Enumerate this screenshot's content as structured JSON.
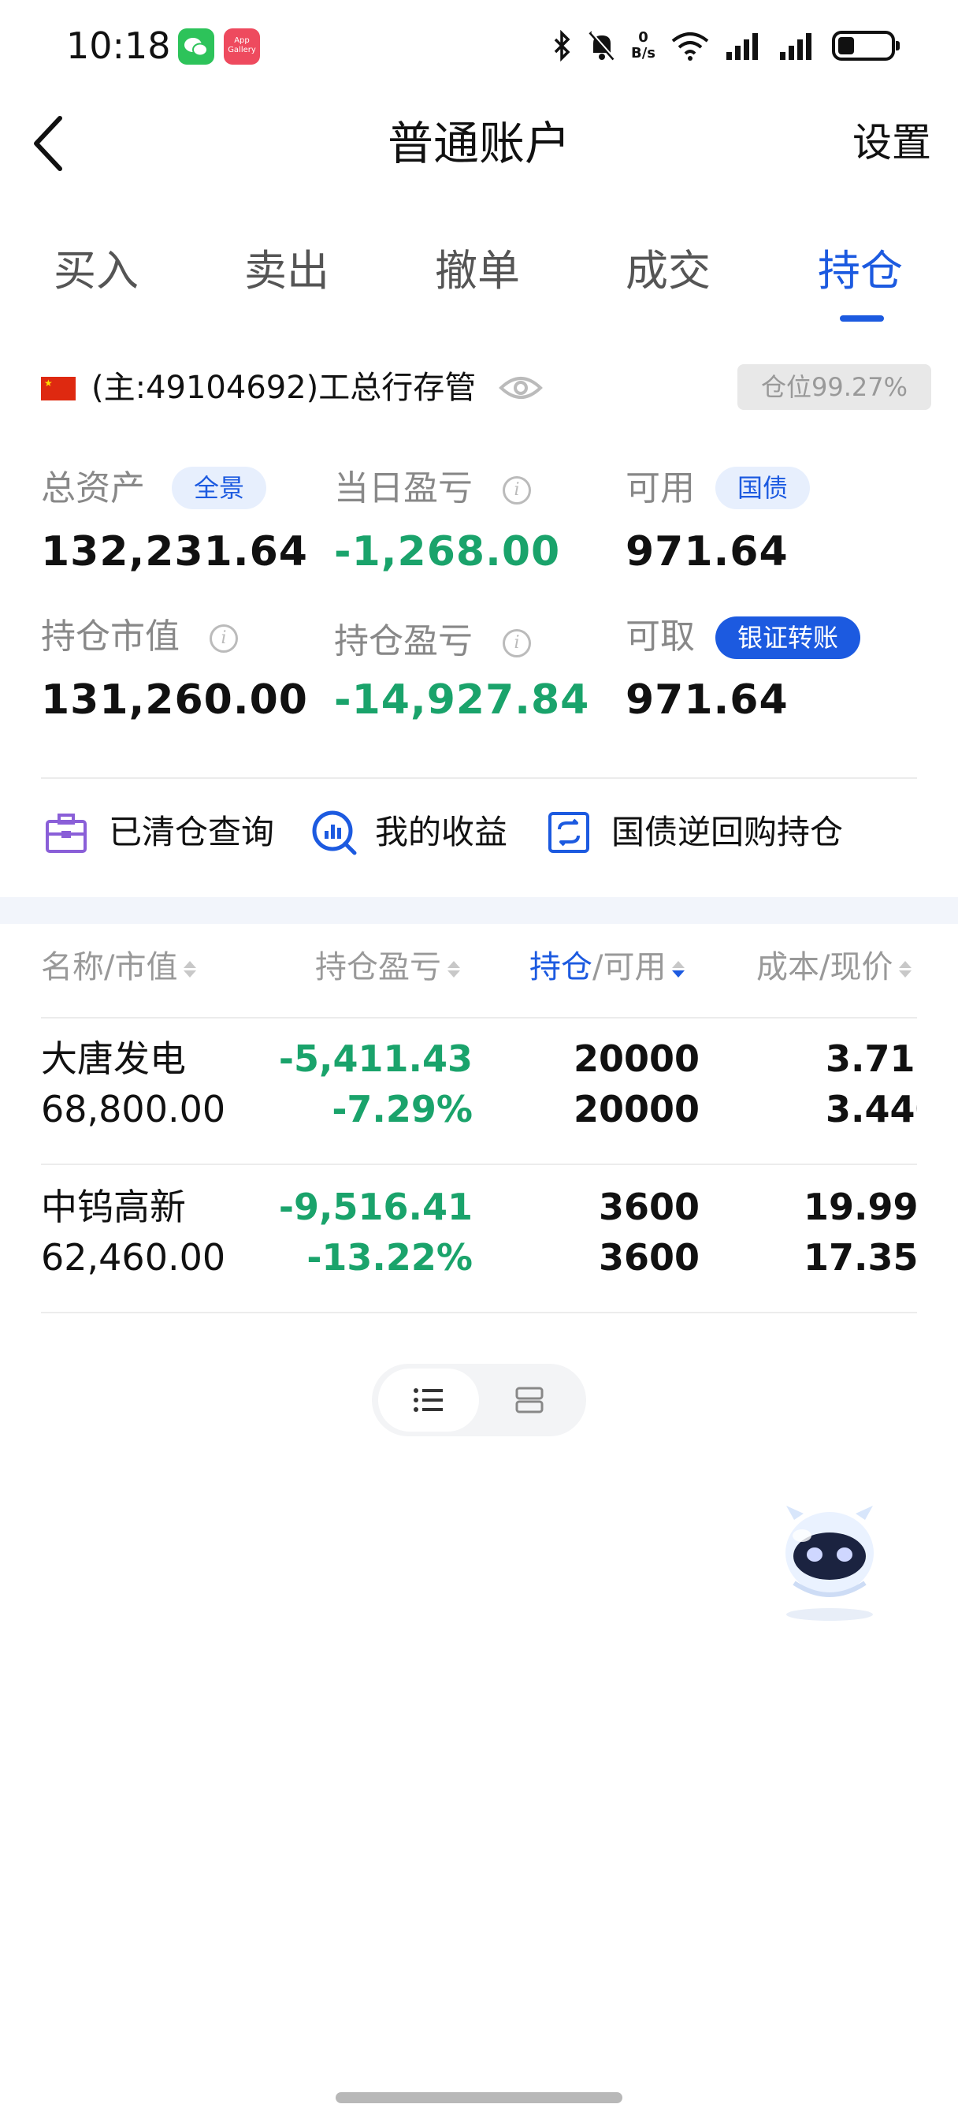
{
  "status_bar": {
    "time": "10:18",
    "gallery_label": "App Gallery",
    "net_speed_value": "0",
    "net_speed_unit": "B/s"
  },
  "nav": {
    "title": "普通账户",
    "settings_label": "设置"
  },
  "tabs": [
    {
      "label": "买入"
    },
    {
      "label": "卖出"
    },
    {
      "label": "撤单"
    },
    {
      "label": "成交"
    },
    {
      "label": "持仓",
      "active": true
    }
  ],
  "account": {
    "name": "(主:49104692)工总行存管",
    "position_ratio_text": "仓位99.27%"
  },
  "summary": {
    "total_assets_label": "总资产",
    "total_assets_chip": "全景",
    "total_assets_value": "132,231.64",
    "daily_pnl_label": "当日盈亏",
    "daily_pnl_value": "-1,268.00",
    "available_label": "可用",
    "available_chip": "国债",
    "available_value": "971.64",
    "market_value_label": "持仓市值",
    "market_value_value": "131,260.00",
    "holding_pnl_label": "持仓盈亏",
    "holding_pnl_value": "-14,927.84",
    "withdrawable_label": "可取",
    "withdrawable_chip": "银证转账",
    "withdrawable_value": "971.64"
  },
  "shortcuts": [
    {
      "label": "已清仓查询"
    },
    {
      "label": "我的收益"
    },
    {
      "label": "国债逆回购持仓"
    }
  ],
  "table": {
    "headers": {
      "name_value": "名称/市值",
      "pnl": "持仓盈亏",
      "position_accent": "持仓",
      "position_rest": "/可用",
      "cost_price": "成本/现价"
    },
    "rows": [
      {
        "name": "大唐发电",
        "market_value": "68,800.00",
        "pnl": "-5,411.43",
        "pnl_pct": "-7.29%",
        "position": "20000",
        "available": "20000",
        "cost": "3.711",
        "price": "3.440"
      },
      {
        "name": "中钨高新",
        "market_value": "62,460.00",
        "pnl": "-9,516.41",
        "pnl_pct": "-13.22%",
        "position": "3600",
        "available": "3600",
        "cost": "19.993",
        "price": "17.350"
      }
    ]
  },
  "colors": {
    "accent": "#1c5ae0",
    "negative": "#1aa36b"
  }
}
